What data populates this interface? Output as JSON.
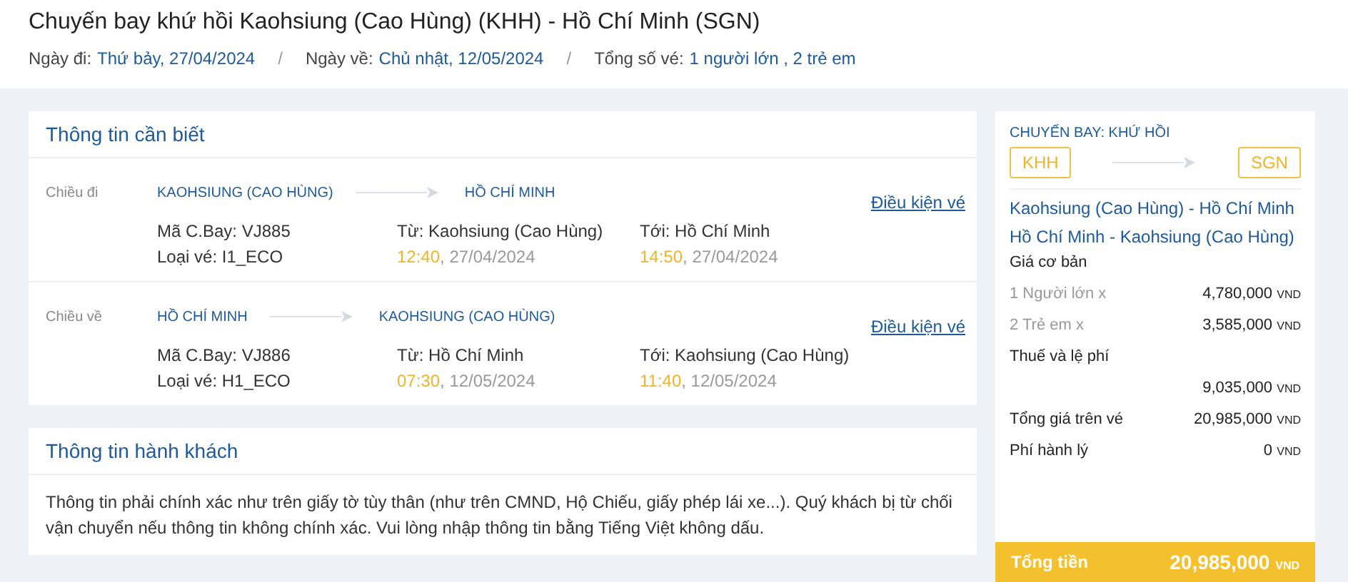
{
  "header": {
    "title": "Chuyến bay khứ hồi Kaohsiung (Cao Hùng) (KHH) - Hồ Chí Minh (SGN)",
    "facts": [
      {
        "label": "Ngày đi:",
        "value": "Thứ bảy, 27/04/2024"
      },
      {
        "label": "Ngày về:",
        "value": "Chủ nhật, 12/05/2024"
      },
      {
        "label": "Tổng số vé:",
        "value": "1 người lớn , 2 trẻ em"
      }
    ],
    "separator": "/"
  },
  "info_card": {
    "title": "Thông tin cần biết",
    "legs": [
      {
        "label": "Chiều đi",
        "from": "KAOHSIUNG (CAO HÙNG)",
        "to": "HỒ CHÍ MINH",
        "link": "Điều kiện vé",
        "flight": "Mã C.Bay: VJ885",
        "fare": "Loại vé: I1_ECO",
        "origin": "Từ: Kaohsiung (Cao Hùng)",
        "destination": "Tới: Hồ Chí Minh",
        "dep_time": "12:40",
        "dep_date": ", 27/04/2024",
        "arr_time": "14:50",
        "arr_date": ", 27/04/2024"
      },
      {
        "label": "Chiều về",
        "from": "HỒ CHÍ MINH",
        "to": "KAOHSIUNG (CAO HÙNG)",
        "link": "Điều kiện vé",
        "flight": "Mã C.Bay: VJ886",
        "fare": "Loại vé: H1_ECO",
        "origin": "Từ: Hồ Chí Minh",
        "destination": "Tới: Kaohsiung (Cao Hùng)",
        "dep_time": "07:30",
        "dep_date": ", 12/05/2024",
        "arr_time": "11:40",
        "arr_date": ", 12/05/2024"
      }
    ]
  },
  "passenger_card": {
    "title": "Thông tin hành khách",
    "note": "Thông tin phải chính xác như trên giấy tờ tùy thân (như trên CMND, Hộ Chiếu, giấy phép lái xe...). Quý khách bị từ chối vận chuyển nếu thông tin không chính xác. Vui lòng nhập thông tin bằng Tiếng Việt không dấu."
  },
  "summary": {
    "trip_type": "CHUYẾN BAY: KHỨ HỒI",
    "from_code": "KHH",
    "to_code": "SGN",
    "routes": [
      "Kaohsiung (Cao Hùng) - Hồ Chí Minh",
      "Hồ Chí Minh - Kaohsiung (Cao Hùng)"
    ],
    "rows": [
      {
        "kind": "heading",
        "label": "Giá cơ bản"
      },
      {
        "kind": "item",
        "label": "1 Người lớn x",
        "amount": "4,780,000",
        "currency": "VND"
      },
      {
        "kind": "item",
        "label": "2 Trẻ em x",
        "amount": "3,585,000",
        "currency": "VND"
      },
      {
        "kind": "heading",
        "label": "Thuế và lệ phí"
      },
      {
        "kind": "amount",
        "amount": "9,035,000",
        "currency": "VND"
      },
      {
        "kind": "total",
        "label": "Tổng giá trên vé",
        "amount": "20,985,000",
        "currency": "VND"
      },
      {
        "kind": "total",
        "label": "Phí hành lý",
        "amount": "0",
        "currency": "VND"
      }
    ],
    "grand_total": {
      "label": "Tổng tiền",
      "amount": "20,985,000",
      "currency": "VND"
    }
  }
}
